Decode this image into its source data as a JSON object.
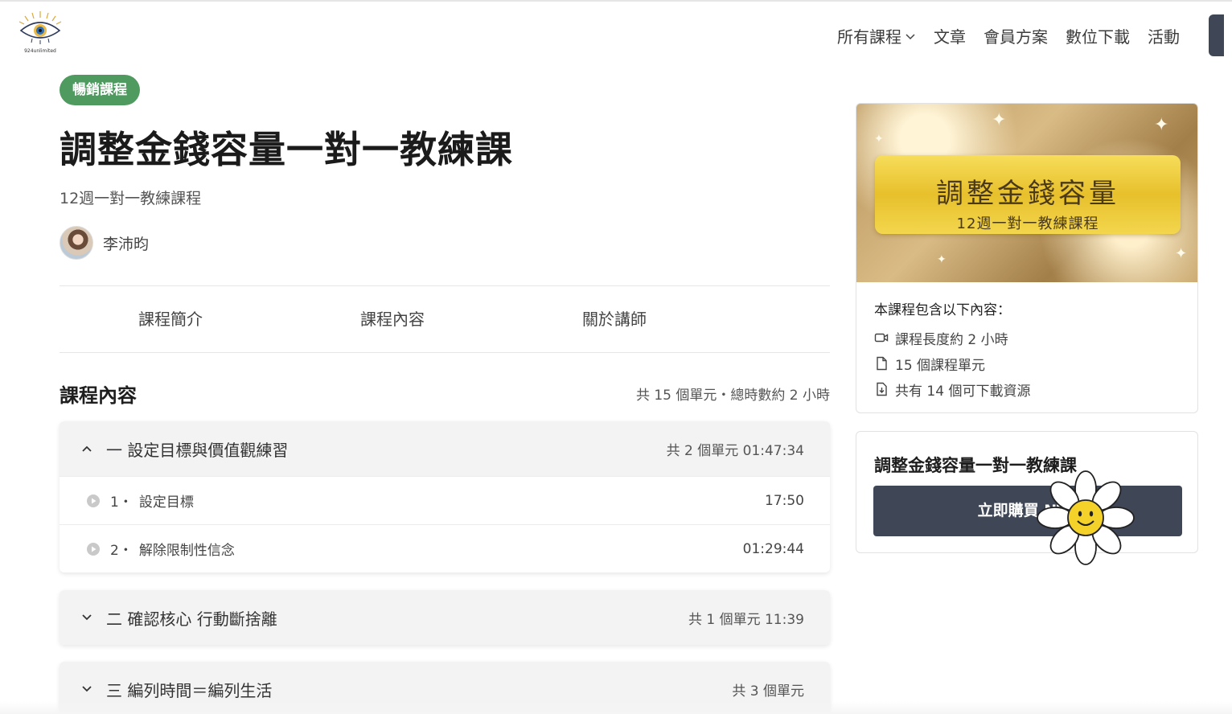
{
  "header": {
    "logo_text": "924unlimited",
    "nav": [
      "所有課程",
      "文章",
      "會員方案",
      "數位下載",
      "活動"
    ]
  },
  "course": {
    "badge": "暢銷課程",
    "title": "調整金錢容量一對一教練課",
    "subtitle": "12週一對一教練課程",
    "author": "李沛昀"
  },
  "tabs": [
    "課程簡介",
    "課程內容",
    "關於講師"
  ],
  "content": {
    "title": "課程內容",
    "meta": "共 15 個單元・總時數約 2 小時",
    "chapters": [
      {
        "name": "一 設定目標與價值觀練習",
        "meta": "共 2 個單元  01:47:34",
        "expanded": true,
        "lessons": [
          {
            "num": "1・",
            "name": "設定目標",
            "dur": "17:50"
          },
          {
            "num": "2・",
            "name": "解除限制性信念",
            "dur": "01:29:44"
          }
        ]
      },
      {
        "name": "二 確認核心 行動斷捨離",
        "meta": "共 1 個單元  11:39",
        "expanded": false
      },
      {
        "name": "三 編列時間＝編列生活",
        "meta": "共 3 個單元",
        "expanded": false
      }
    ]
  },
  "sidebar": {
    "hero_title": "調整金錢容量",
    "hero_sub": "12週一對一教練課程",
    "includes_title": "本課程包含以下內容：",
    "includes": [
      {
        "icon": "video-icon",
        "text": "課程長度約 2 小時"
      },
      {
        "icon": "document-icon",
        "text": "15 個課程單元"
      },
      {
        "icon": "download-file-icon",
        "text": "共有 14 個可下載資源"
      }
    ],
    "purchase_title": "調整金錢容量一對一教練課",
    "buy_label": "立即購買 NT$"
  },
  "colors": {
    "badge": "#4f9a5f",
    "button": "#3f4656",
    "plate": "#e7c02c"
  }
}
